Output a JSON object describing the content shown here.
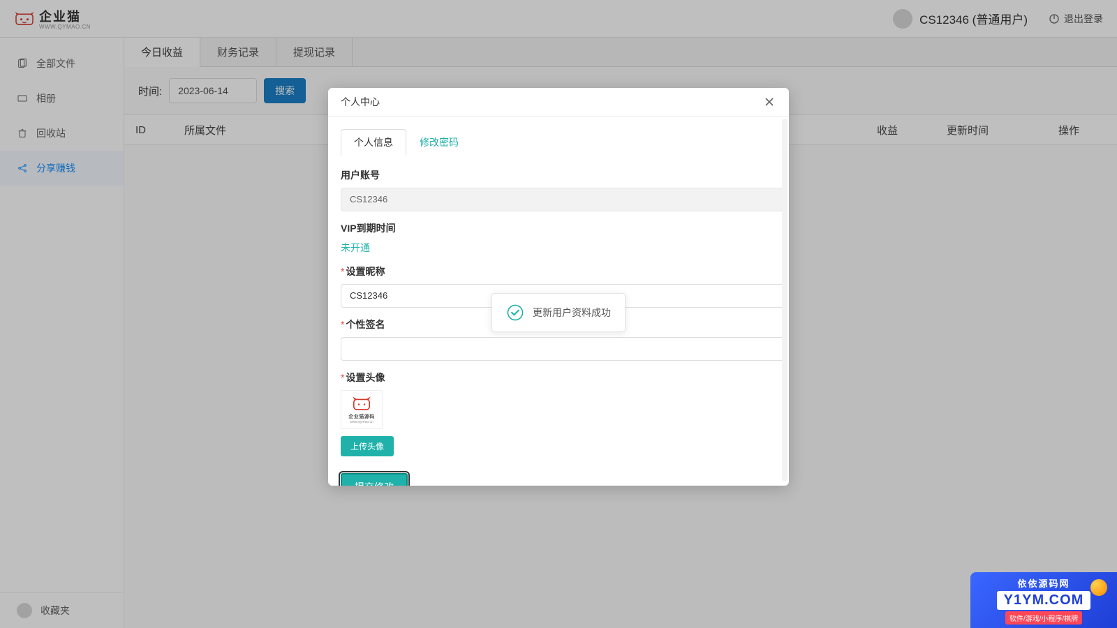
{
  "header": {
    "logo_text": "企业猫",
    "logo_sub": "WWW.QYMAO.CN",
    "user_label": "CS12346 (普通用户)",
    "logout_label": "退出登录"
  },
  "sidebar": {
    "items": [
      {
        "label": "全部文件",
        "icon": "files"
      },
      {
        "label": "相册",
        "icon": "album"
      },
      {
        "label": "回收站",
        "icon": "trash"
      },
      {
        "label": "分享赚钱",
        "icon": "share",
        "active": true
      }
    ],
    "footer_label": "收藏夹"
  },
  "tabs": [
    {
      "label": "今日收益",
      "active": true
    },
    {
      "label": "财务记录"
    },
    {
      "label": "提现记录"
    }
  ],
  "filter": {
    "label": "时间:",
    "date_value": "2023-06-14",
    "search_label": "搜索"
  },
  "table_headers": {
    "id": "ID",
    "file": "所属文件",
    "income": "收益",
    "time": "更新时间",
    "ops": "操作"
  },
  "modal": {
    "title": "个人中心",
    "tabs": {
      "info": "个人信息",
      "pwd": "修改密码"
    },
    "account_label": "用户账号",
    "account_value": "CS12346",
    "vip_label": "VIP到期时间",
    "vip_value": "未开通",
    "nickname_label": "设置昵称",
    "nickname_value": "CS12346",
    "signature_label": "个性签名",
    "signature_value": "",
    "avatar_label": "设置头像",
    "avatar_caption": "企业猫源码",
    "upload_label": "上传头像",
    "submit_label": "提交修改"
  },
  "toast": {
    "message": "更新用户资料成功"
  },
  "watermark": {
    "top": "依依源码网",
    "mid": "Y1YM.COM",
    "bot": "软件/游戏/小程序/棋牌"
  }
}
